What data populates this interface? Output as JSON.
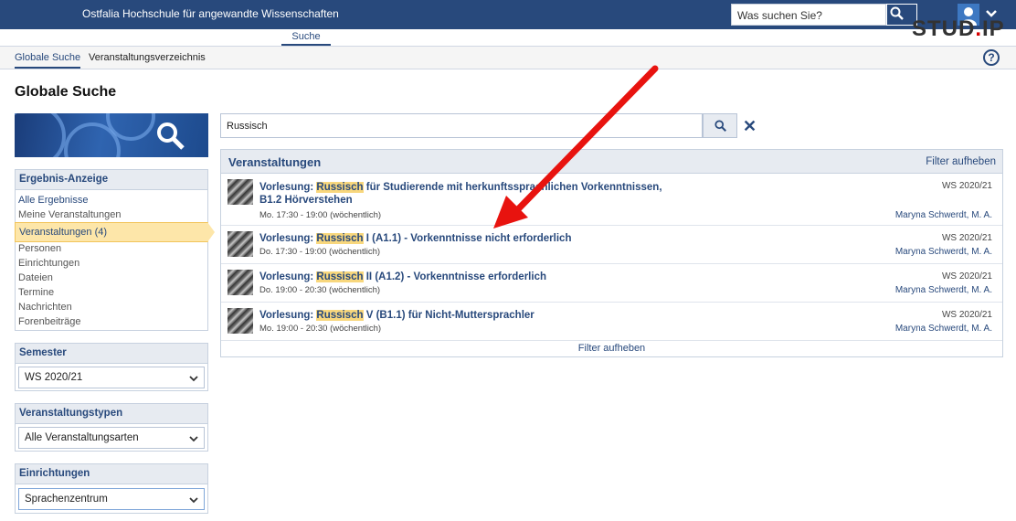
{
  "header": {
    "institution": "Ostfalia Hochschule für angewandte Wissenschaften",
    "search_placeholder": "Was suchen Sie?",
    "logo_text": "STUD.IP"
  },
  "subnav": {
    "active_tab": "Suche"
  },
  "tabs": [
    {
      "label": "Globale Suche",
      "active": true
    },
    {
      "label": "Veranstaltungsverzeichnis",
      "active": false
    }
  ],
  "page_title": "Globale Suche",
  "sidebar": {
    "result_heading": "Ergebnis-Anzeige",
    "result_items": [
      "Alle Ergebnisse",
      "Meine Veranstaltungen",
      "Veranstaltungen (4)",
      "Personen",
      "Einrichtungen",
      "Dateien",
      "Termine",
      "Nachrichten",
      "Forenbeiträge"
    ],
    "semester": {
      "heading": "Semester",
      "selected": "WS 2020/21"
    },
    "types": {
      "heading": "Veranstaltungstypen",
      "selected": "Alle Veranstaltungsarten"
    },
    "institutes": {
      "heading": "Einrichtungen",
      "selected": "Sprachenzentrum"
    }
  },
  "search": {
    "query": "Russisch"
  },
  "results": {
    "heading": "Veranstaltungen",
    "filter_label": "Filter aufheben",
    "footer_filter": "Filter aufheben",
    "rows": [
      {
        "prefix": "Vorlesung: ",
        "highlight": "Russisch",
        "rest": " für Studierende mit herkunftssprachlichen Vorkenntnissen,",
        "line2": "B1.2 Hörverstehen",
        "time": "Mo. 17:30 - 19:00 (wöchentlich)",
        "semester": "WS 2020/21",
        "lecturer": "Maryna Schwerdt, M. A."
      },
      {
        "prefix": "Vorlesung: ",
        "highlight": "Russisch",
        "rest": " I (A1.1) - Vorkenntnisse nicht erforderlich",
        "line2": "",
        "time": "Do. 17:30 - 19:00 (wöchentlich)",
        "semester": "WS 2020/21",
        "lecturer": "Maryna Schwerdt, M. A."
      },
      {
        "prefix": "Vorlesung: ",
        "highlight": "Russisch",
        "rest": " II (A1.2) - Vorkenntnisse erforderlich",
        "line2": "",
        "time": "Do. 19:00 - 20:30 (wöchentlich)",
        "semester": "WS 2020/21",
        "lecturer": "Maryna Schwerdt, M. A."
      },
      {
        "prefix": "Vorlesung: ",
        "highlight": "Russisch",
        "rest": " V (B1.1) für Nicht-Muttersprachler",
        "line2": "",
        "time": "Mo. 19:00 - 20:30 (wöchentlich)",
        "semester": "WS 2020/21",
        "lecturer": "Maryna Schwerdt, M. A."
      }
    ]
  },
  "colors": {
    "brand": "#28497c",
    "highlight": "#f8d77d",
    "active_item": "#fde6a9",
    "annotation_arrow": "#e8130f"
  }
}
